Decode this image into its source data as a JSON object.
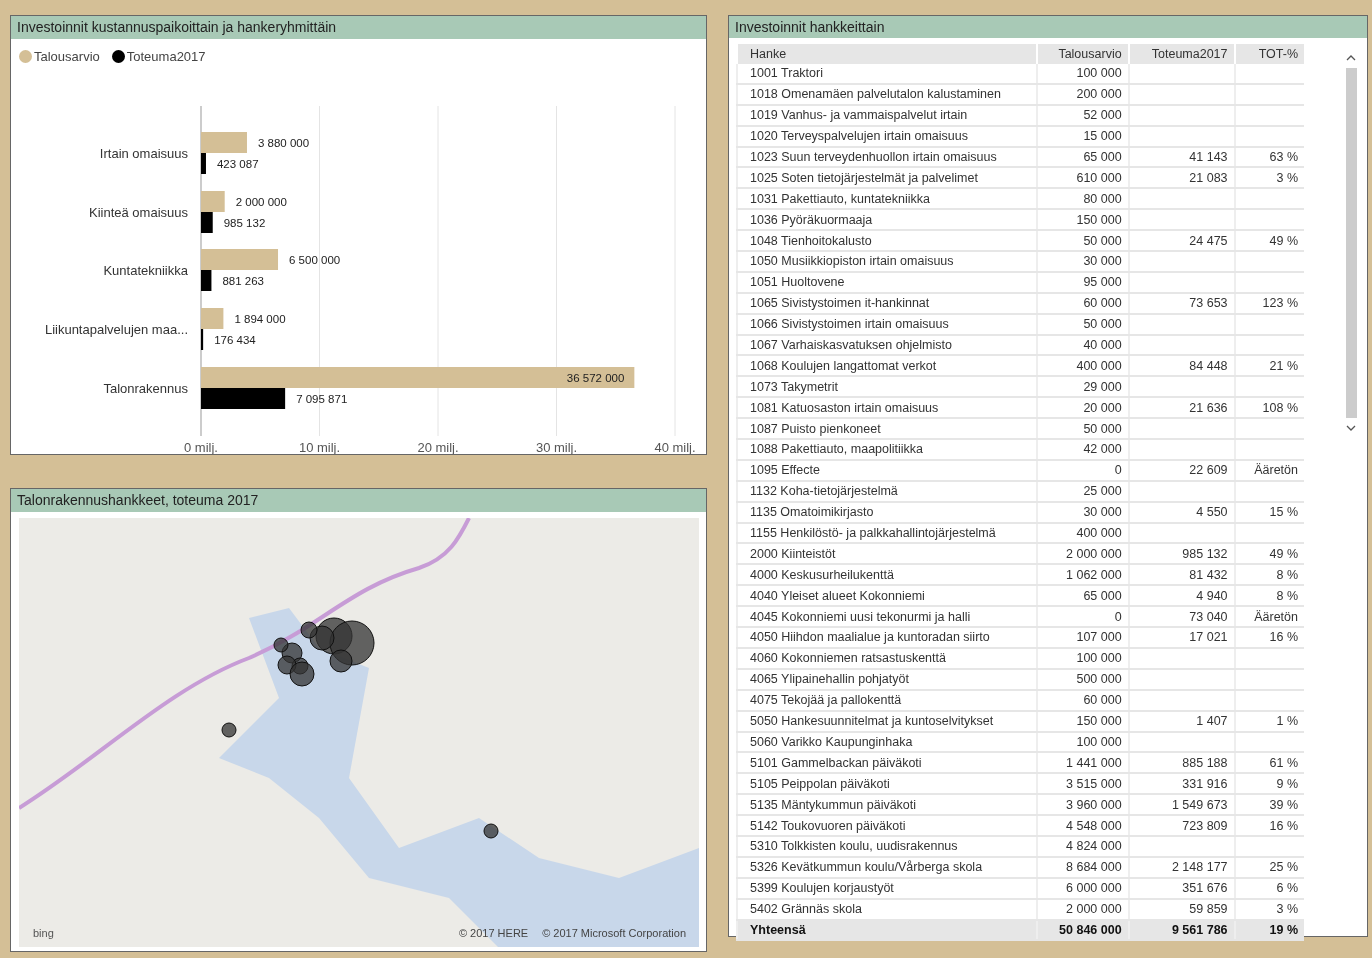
{
  "chart_panel": {
    "title": "Investoinnit kustannuspaikoittain ja hankeryhmittäin",
    "chart_data": {
      "type": "bar",
      "orientation": "horizontal",
      "categories": [
        "Irtain omaisuus",
        "Kiinteä omaisuus",
        "Kuntatekniikka",
        "Liikuntapalvelujen maa...",
        "Talonrakennus"
      ],
      "series": [
        {
          "name": "Talousarvio",
          "color": "#d4bf96",
          "values": [
            3.88,
            2.0,
            6.5,
            1.89,
            36.57
          ]
        },
        {
          "name": "Toteuma2017",
          "color": "#000000",
          "values": [
            0.42,
            0.99,
            0.88,
            0.18,
            7.1
          ]
        }
      ],
      "value_labels": [
        [
          "3 880 000",
          "2 000 000",
          "6 500 000",
          "1 894 000",
          "36 572 000"
        ],
        [
          "423 087",
          "985 132",
          "881 263",
          "176 434",
          "7 095 871"
        ]
      ],
      "grid": true,
      "xlim": [
        0,
        40
      ],
      "xticks": [
        {
          "value": 0,
          "label": "0 milj."
        },
        {
          "value": 10,
          "label": "10 milj."
        },
        {
          "value": 20,
          "label": "20 milj."
        },
        {
          "value": 30,
          "label": "30 milj."
        },
        {
          "value": 40,
          "label": "40 milj."
        }
      ]
    }
  },
  "map_panel": {
    "title": "Talonrakennushankkeet, toteuma 2017",
    "logo": "bing",
    "attribution": [
      "© 2017 HERE",
      "© 2017 Microsoft Corporation"
    ]
  },
  "table_panel": {
    "title": "Investoinnit hankkeittain",
    "columns": [
      "Hanke",
      "Talousarvio",
      "Toteuma2017",
      "TOT-%"
    ],
    "rows": [
      [
        "1001 Traktori",
        "100 000",
        "",
        ""
      ],
      [
        "1018 Omenamäen palvelutalon kalustaminen",
        "200 000",
        "",
        ""
      ],
      [
        "1019 Vanhus- ja vammaispalvelut irtain",
        "52 000",
        "",
        ""
      ],
      [
        "1020 Terveyspalvelujen irtain omaisuus",
        "15 000",
        "",
        ""
      ],
      [
        "1023 Suun terveydenhuollon irtain omaisuus",
        "65 000",
        "41 143",
        "63 %"
      ],
      [
        "1025 Soten tietojärjestelmät ja palvelimet",
        "610 000",
        "21 083",
        "3 %"
      ],
      [
        "1031 Pakettiauto, kuntatekniikka",
        "80 000",
        "",
        ""
      ],
      [
        "1036 Pyöräkuormaaja",
        "150 000",
        "",
        ""
      ],
      [
        "1048 Tienhoitokalusto",
        "50 000",
        "24 475",
        "49 %"
      ],
      [
        "1050 Musiikkiopiston irtain omaisuus",
        "30 000",
        "",
        ""
      ],
      [
        "1051 Huoltovene",
        "95 000",
        "",
        ""
      ],
      [
        "1065 Sivistystoimen it-hankinnat",
        "60 000",
        "73 653",
        "123 %"
      ],
      [
        "1066 Sivistystoimen irtain omaisuus",
        "50 000",
        "",
        ""
      ],
      [
        "1067 Varhaiskasvatuksen ohjelmisto",
        "40 000",
        "",
        ""
      ],
      [
        "1068 Koulujen langattomat verkot",
        "400 000",
        "84 448",
        "21 %"
      ],
      [
        "1073 Takymetrit",
        "29 000",
        "",
        ""
      ],
      [
        "1081 Katuosaston irtain omaisuus",
        "20 000",
        "21 636",
        "108 %"
      ],
      [
        "1087 Puisto pienkoneet",
        "50 000",
        "",
        ""
      ],
      [
        "1088 Pakettiauto, maapolitiikka",
        "42 000",
        "",
        ""
      ],
      [
        "1095 Effecte",
        "0",
        "22 609",
        "Ääretön"
      ],
      [
        "1132 Koha-tietojärjestelmä",
        "25 000",
        "",
        ""
      ],
      [
        "1135 Omatoimikirjasto",
        "30 000",
        "4 550",
        "15 %"
      ],
      [
        "1155 Henkilöstö- ja palkkahallintojärjestelmä",
        "400 000",
        "",
        ""
      ],
      [
        "2000 Kiinteistöt",
        "2 000 000",
        "985 132",
        "49 %"
      ],
      [
        "4000 Keskusurheilukenttä",
        "1 062 000",
        "81 432",
        "8 %"
      ],
      [
        "4040 Yleiset alueet Kokonniemi",
        "65 000",
        "4 940",
        "8 %"
      ],
      [
        "4045 Kokonniemi uusi tekonurmi ja halli",
        "0",
        "73 040",
        "Ääretön"
      ],
      [
        "4050 Hiihdon maalialue ja kuntoradan siirto",
        "107 000",
        "17 021",
        "16 %"
      ],
      [
        "4060 Kokonniemen ratsastuskenttä",
        "100 000",
        "",
        ""
      ],
      [
        "4065 Ylipainehallin pohjatyöt",
        "500 000",
        "",
        ""
      ],
      [
        "4075 Tekojää ja pallokenttä",
        "60 000",
        "",
        ""
      ],
      [
        "5050 Hankesuunnitelmat ja kuntoselvitykset",
        "150 000",
        "1 407",
        "1 %"
      ],
      [
        "5060 Varikko Kaupunginhaka",
        "100 000",
        "",
        ""
      ],
      [
        "5101 Gammelbackan päiväkoti",
        "1 441 000",
        "885 188",
        "61 %"
      ],
      [
        "5105 Peippolan päiväkoti",
        "3 515 000",
        "331 916",
        "9 %"
      ],
      [
        "5135 Mäntykummun päiväkoti",
        "3 960 000",
        "1 549 673",
        "39 %"
      ],
      [
        "5142 Toukovuoren päiväkoti",
        "4 548 000",
        "723 809",
        "16 %"
      ],
      [
        "5310 Tolkkisten koulu, uudisrakennus",
        "4 824 000",
        "",
        ""
      ],
      [
        "5326 Kevätkummun koulu/Vårberga skola",
        "8 684 000",
        "2 148 177",
        "25 %"
      ],
      [
        "5399 Koulujen korjaustyöt",
        "6 000 000",
        "351 676",
        "6 %"
      ],
      [
        "5402 Grännäs skola",
        "2 000 000",
        "59 859",
        "3 %"
      ]
    ],
    "total": [
      "Yhteensä",
      "50 846 000",
      "9 561 786",
      "19 %"
    ]
  }
}
